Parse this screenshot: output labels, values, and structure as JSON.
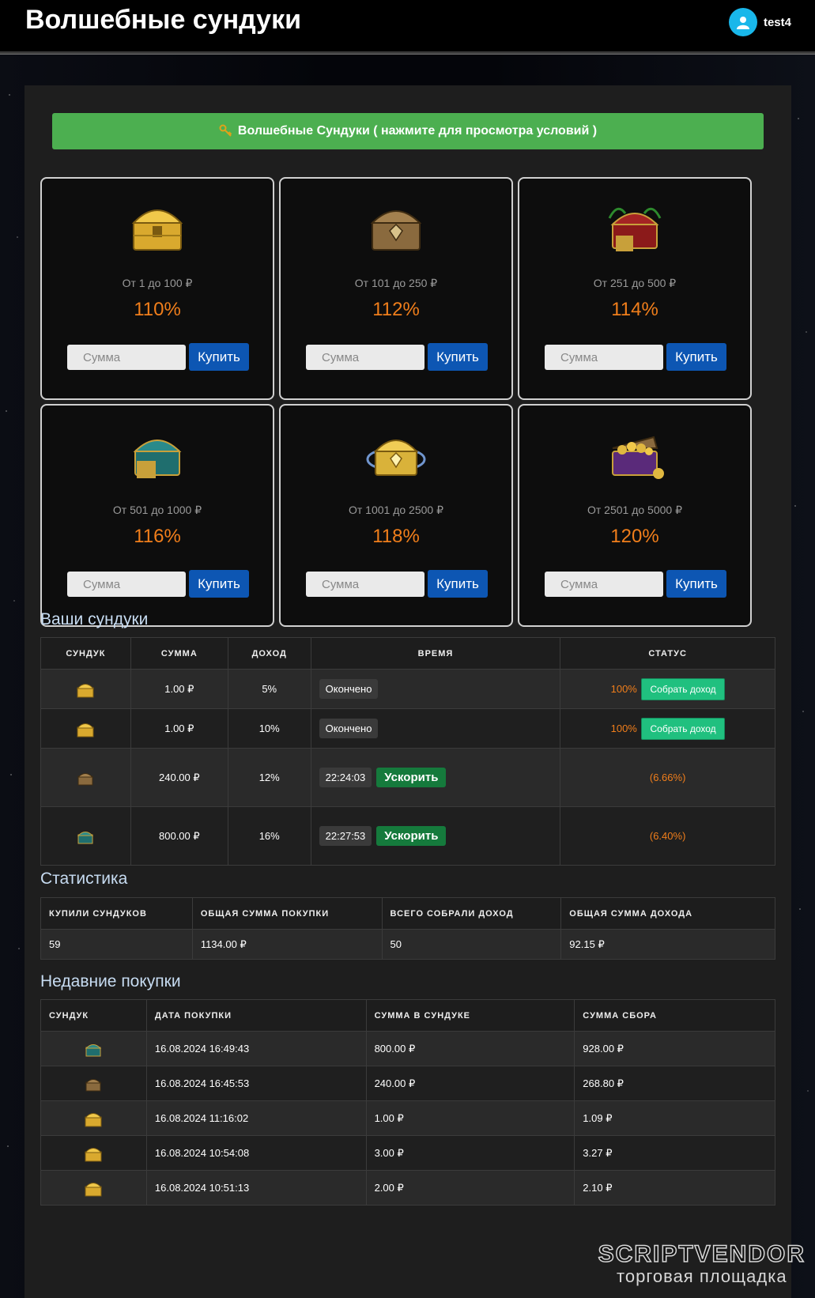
{
  "header": {
    "title": "Волшебные сундуки",
    "username": "test4"
  },
  "conditions_button": {
    "label": "Волшебные Сундуки ( нажмите для просмотра условий )"
  },
  "chests": [
    {
      "range": "От 1 до 100 ₽",
      "percent": "110%",
      "placeholder": "Сумма",
      "buy_label": "Купить",
      "color": "#d9a92e"
    },
    {
      "range": "От 101 до 250 ₽",
      "percent": "112%",
      "placeholder": "Сумма",
      "buy_label": "Купить",
      "color": "#8a6a3e"
    },
    {
      "range": "От 251 до 500 ₽",
      "percent": "114%",
      "placeholder": "Сумма",
      "buy_label": "Купить",
      "color": "#8b1a1a"
    },
    {
      "range": "От 501 до 1000 ₽",
      "percent": "116%",
      "placeholder": "Сумма",
      "buy_label": "Купить",
      "color": "#1f6e6e"
    },
    {
      "range": "От 1001 до 2500 ₽",
      "percent": "118%",
      "placeholder": "Сумма",
      "buy_label": "Купить",
      "color": "#d9b23a"
    },
    {
      "range": "От 2501 до 5000 ₽",
      "percent": "120%",
      "placeholder": "Сумма",
      "buy_label": "Купить",
      "color": "#5a2a7a"
    }
  ],
  "your_chests": {
    "title": "Ваши сундуки",
    "headers": [
      "СУНДУК",
      "СУММА",
      "ДОХОД",
      "ВРЕМЯ",
      "СТАТУС"
    ],
    "rows": [
      {
        "amount": "1.00 ₽",
        "income": "5%",
        "time": "Окончено",
        "status_pct": "100%",
        "collect_label": "Собрать доход"
      },
      {
        "amount": "1.00 ₽",
        "income": "10%",
        "time": "Окончено",
        "status_pct": "100%",
        "collect_label": "Собрать доход"
      },
      {
        "amount": "240.00 ₽",
        "income": "12%",
        "time": "22:24:03",
        "speed_label": "Ускорить",
        "status_pct": "(6.66%)"
      },
      {
        "amount": "800.00 ₽",
        "income": "16%",
        "time": "22:27:53",
        "speed_label": "Ускорить",
        "status_pct": "(6.40%)"
      }
    ]
  },
  "stats": {
    "title": "Статистика",
    "headers": [
      "КУПИЛИ СУНДУКОВ",
      "ОБЩАЯ СУММА ПОКУПКИ",
      "ВСЕГО СОБРАЛИ ДОХОД",
      "ОБЩАЯ СУММА ДОХОДА"
    ],
    "values": [
      "59",
      "1134.00 ₽",
      "50",
      "92.15 ₽"
    ]
  },
  "recent": {
    "title": "Недавние покупки",
    "headers": [
      "СУНДУК",
      "ДАТА ПОКУПКИ",
      "СУММА В СУНДУКЕ",
      "СУММА СБОРА"
    ],
    "rows": [
      {
        "date": "16.08.2024 16:49:43",
        "amount": "800.00 ₽",
        "collect": "928.00 ₽"
      },
      {
        "date": "16.08.2024 16:45:53",
        "amount": "240.00 ₽",
        "collect": "268.80 ₽"
      },
      {
        "date": "16.08.2024 11:16:02",
        "amount": "1.00 ₽",
        "collect": "1.09 ₽"
      },
      {
        "date": "16.08.2024 10:54:08",
        "amount": "3.00 ₽",
        "collect": "3.27 ₽"
      },
      {
        "date": "16.08.2024 10:51:13",
        "amount": "2.00 ₽",
        "collect": "2.10 ₽"
      }
    ]
  },
  "watermark": {
    "line1": "SCRIPTVENDOR",
    "line2": "торговая площадка"
  }
}
